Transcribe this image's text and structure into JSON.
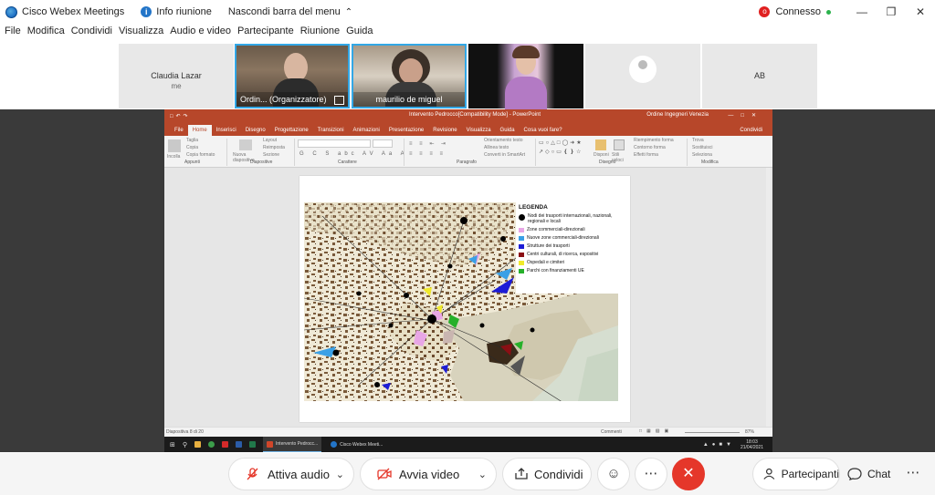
{
  "titlebar": {
    "app_name": "Cisco Webex Meetings",
    "info": "Info riunione",
    "hide_menu": "Nascondi barra del menu",
    "status": "Connesso"
  },
  "menu": [
    "File",
    "Modifica",
    "Condividi",
    "Visualizza",
    "Audio e video",
    "Partecipante",
    "Riunione",
    "Guida"
  ],
  "participants": {
    "me_name": "Claudia Lazar",
    "me_tag": "me",
    "host_label": "Ordin... (Organizzatore)",
    "second": "maurilio de miguel",
    "initials": "AB"
  },
  "ppt": {
    "doc_title": "Intervento Pedrocco[Compatibility Mode] - PowerPoint",
    "user": "Ordine Ingegneri Venezia",
    "share_tab": "Condividi",
    "tabs": [
      "File",
      "Home",
      "Inserisci",
      "Disegno",
      "Progettazione",
      "Transizioni",
      "Animazioni",
      "Presentazione",
      "Revisione",
      "Visualizza",
      "Guida",
      "Cosa vuoi fare?"
    ],
    "groups": [
      "Appunti",
      "Diapositive",
      "Carattere",
      "Paragrafo",
      "Disegno",
      "Modifica"
    ],
    "buttons": {
      "paste": "Incolla",
      "cut": "Taglia",
      "copy": "Copia",
      "format": "Copia formato",
      "new_slide": "Nuova diapositiva",
      "layout": "Layout",
      "reset": "Reimposta",
      "section": "Sezione",
      "find": "Trova",
      "replace": "Sostituisci",
      "select": "Seleziona",
      "arrange": "Disponi",
      "quick_styles": "Stili veloci",
      "shape_fill": "Riempimento forma",
      "shape_outline": "Contorno forma",
      "shape_effects": "Effetti forma",
      "text_direction": "Orientamento testo",
      "align_text": "Allinea testo",
      "smartart": "Converti in SmartArt"
    },
    "status_slide": "Diapositiva 8 di 20",
    "status_comments": "Commenti",
    "zoom": "87%",
    "legend_title": "LEGENDA",
    "legend": [
      {
        "label": "Nodi dei trasporti internazionali, nazionali, regionali e locali",
        "color": "#000000",
        "shape": "dot"
      },
      {
        "label": "Zone commerciali-direzionali",
        "color": "#e8a6e6"
      },
      {
        "label": "Nuove zone commerciali-direzionali",
        "color": "#3aa0e6"
      },
      {
        "label": "Strutture dei trasporti",
        "color": "#1c1cd6"
      },
      {
        "label": "Centri culturali, di ricerca, espositivi",
        "color": "#8a0f14"
      },
      {
        "label": "Ospedali e cimiteri",
        "color": "#f0ea2a"
      },
      {
        "label": "Parchi con finanziamenti UE",
        "color": "#26b02a"
      }
    ],
    "taskbar_apps": [
      "Intervento Pedrocc...",
      "Cisco Webex Meeti..."
    ],
    "clock_time": "18:03",
    "clock_date": "21/04/2021"
  },
  "controls": {
    "audio": "Attiva audio",
    "video": "Avvia video",
    "share": "Condividi",
    "participants": "Partecipanti",
    "chat": "Chat"
  }
}
